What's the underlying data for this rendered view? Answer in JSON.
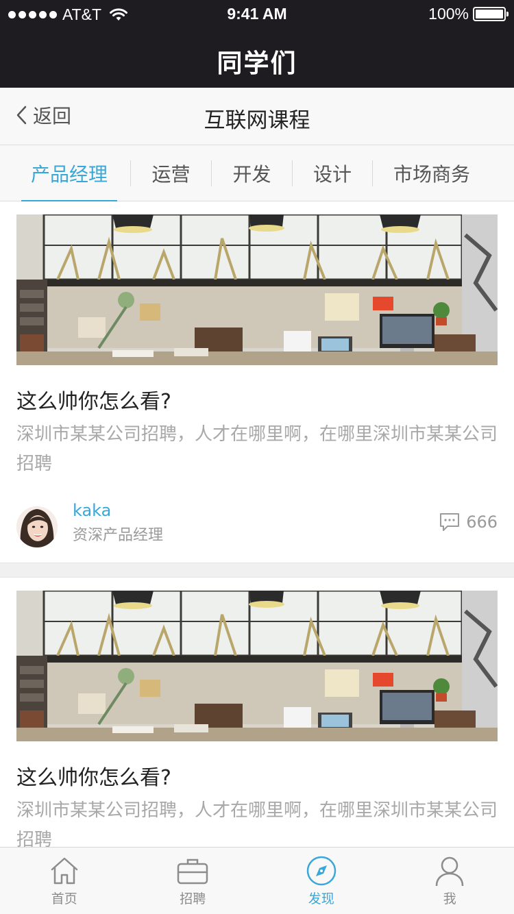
{
  "status_bar": {
    "carrier": "AT&T",
    "time": "9:41 AM",
    "battery": "100%"
  },
  "app_title": "同学们",
  "navbar": {
    "back_label": "返回",
    "title": "互联网课程"
  },
  "tabs": [
    {
      "label": "产品经理",
      "active": true
    },
    {
      "label": "运营",
      "active": false
    },
    {
      "label": "开发",
      "active": false
    },
    {
      "label": "设计",
      "active": false
    },
    {
      "label": "市场商务",
      "active": false
    }
  ],
  "posts": [
    {
      "title": "这么帅你怎么看?",
      "description": "深圳市某某公司招聘，人才在哪里啊，在哪里深圳市某某公司招聘",
      "author": "kaka",
      "role": "资深产品经理",
      "comment_count": "666"
    },
    {
      "title": "这么帅你怎么看?",
      "description": "深圳市某某公司招聘，人才在哪里啊，在哪里深圳市某某公司招聘"
    }
  ],
  "tabbar": [
    {
      "label": "首页",
      "icon": "home-icon",
      "active": false
    },
    {
      "label": "招聘",
      "icon": "briefcase-icon",
      "active": false
    },
    {
      "label": "发现",
      "icon": "compass-icon",
      "active": true
    },
    {
      "label": "我",
      "icon": "person-icon",
      "active": false
    }
  ],
  "colors": {
    "accent": "#3aa7d9",
    "header_bg": "#1e1c20"
  }
}
